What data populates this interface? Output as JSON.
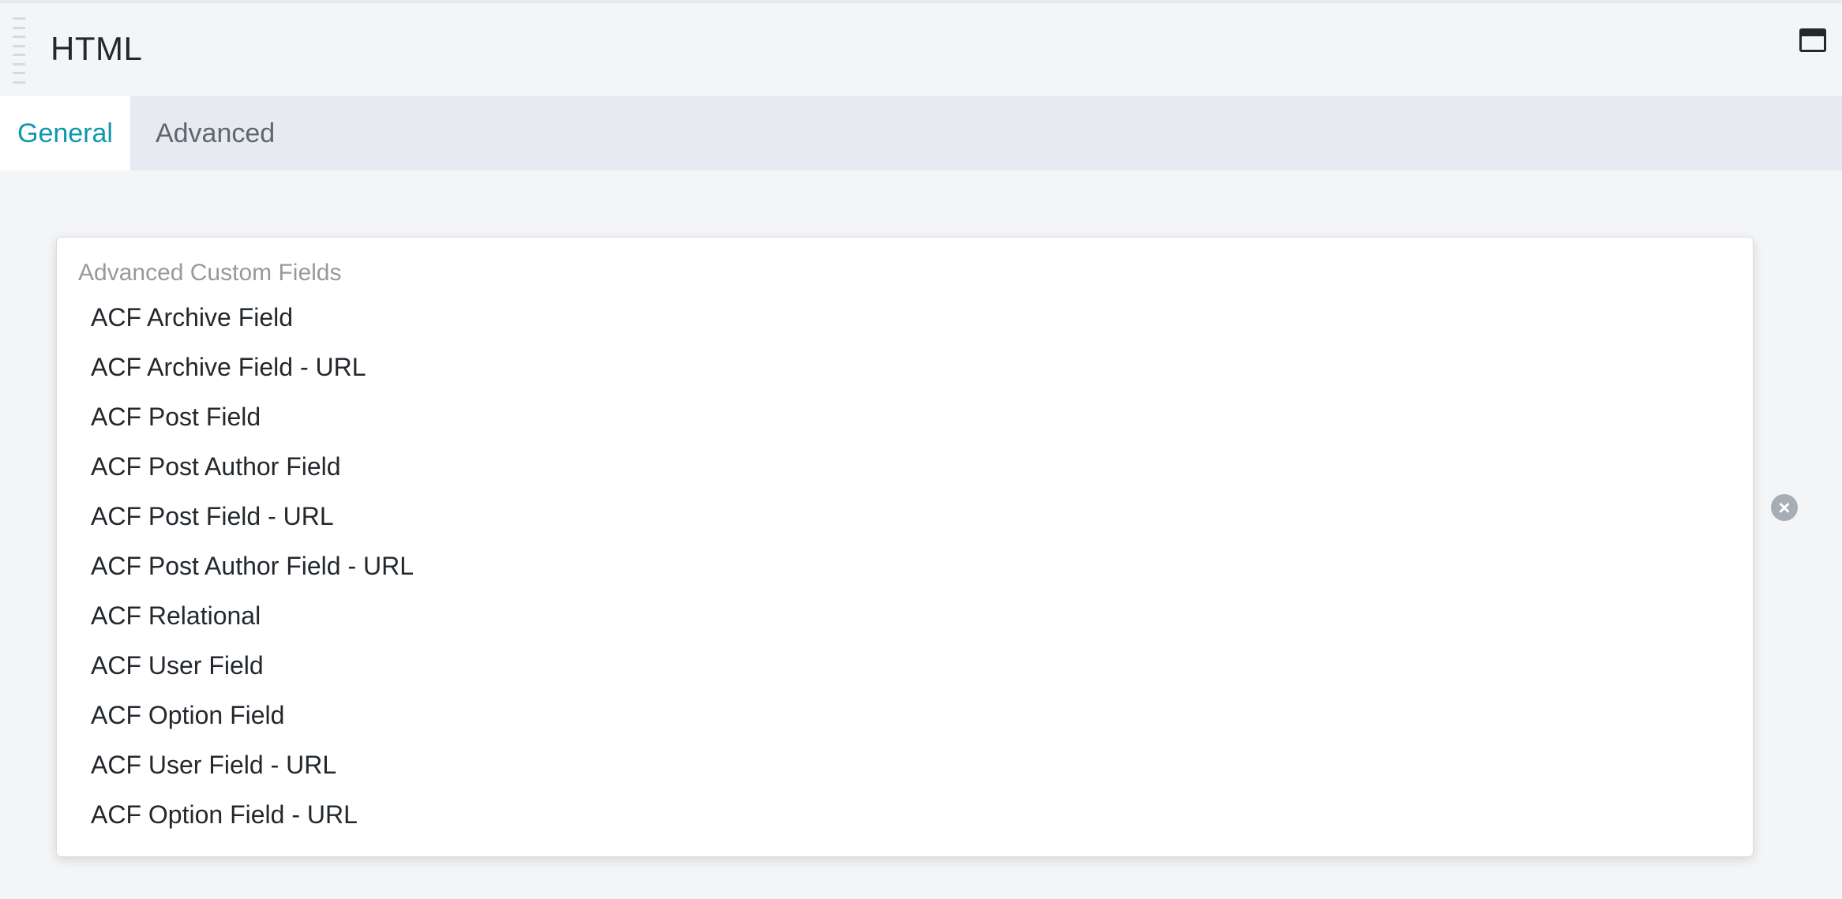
{
  "header": {
    "title": "HTML",
    "window_icon": "window-maximize-icon"
  },
  "tabs": [
    {
      "label": "General",
      "active": true
    },
    {
      "label": "Advanced",
      "active": false
    }
  ],
  "dropdown": {
    "group_label": "Advanced Custom Fields",
    "options": [
      "ACF Archive Field",
      "ACF Archive Field - URL",
      "ACF Post Field",
      "ACF Post Author Field",
      "ACF Post Field - URL",
      "ACF Post Author Field - URL",
      "ACF Relational",
      "ACF User Field",
      "ACF Option Field",
      "ACF User Field - URL",
      "ACF Option Field - URL"
    ]
  },
  "clear_button": {
    "icon": "clear-x-icon",
    "glyph": "×"
  },
  "colors": {
    "accent": "#0e97ad",
    "background": "#f4f5f7",
    "tab_bar": "#e7eaf1"
  }
}
